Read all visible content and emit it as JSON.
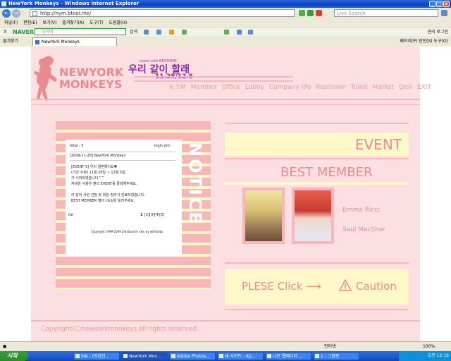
{
  "window": {
    "title": "NewYork Monkeys - Windows Internet Explorer",
    "url": "http://nym.btool.me/",
    "live_search_placeholder": "Live Search"
  },
  "menu": [
    "파일(F)",
    "편집(E)",
    "보기(V)",
    "즐겨찾기(A)",
    "도구(T)",
    "도움말(H)"
  ],
  "naver": {
    "logo": "NAVER",
    "close": "X",
    "placeholder": "네이버",
    "search_label": "검색",
    "manage": "관리",
    "login": "로그인"
  },
  "tabs": {
    "favorites": "즐겨찾기",
    "active_tab": "NewYork Monkeys",
    "tools": "페이지(P)   안전(S)   도구(O)"
  },
  "site": {
    "logo_line1": "NEWYORK",
    "logo_line2": "MONKEYS",
    "event_small": "event with BESTMEM",
    "event_title": "우리 같이 할래",
    "event_date": "11.28/12.5",
    "nav": [
      "N.Y.M",
      "Member",
      "Office",
      "Lobby",
      "Company life",
      "Restroom",
      "Toilet",
      "Market",
      "QnA",
      "EXIT"
    ],
    "notice_label": "NOTICE",
    "notice": {
      "total": "total : 5",
      "login_join": "login  join",
      "date_title": "[2009-11-28]  NewYork Monkeys",
      "lines": [
        "[EVENT 5] 우리 결혼했어요♥",
        "(기간 수정) 11월 28일 ~ 12월 5일",
        "가 시작되었습니다^^",
        "자세한 사항은 옆의 EVENT를 클릭해주세요.",
        "",
        "이 달의 사원 선정 및 회원 정리가 완료되었습니다.",
        "BEST MEMBER 옆의 click을 눌러주세요."
      ],
      "list": "list",
      "pages_current": "1",
      "pages": "[2][3][4][5]",
      "copyright": "Copyright 1999-2009 Zeroboard / skin by withbaby"
    },
    "event_label": "EVENT",
    "best_member_title": "BEST MEMBER",
    "members": [
      "Emma Ricci",
      "Saul MacSher"
    ],
    "please_click": "PLESE Click ⟶",
    "caution": "Caution",
    "copyright": "Copyright(C)newyorkmonkeys all rights reserved."
  },
  "status": {
    "zone": "인터넷",
    "zoom": "100%"
  },
  "taskbar": {
    "start": "시작",
    "tasks": [
      "SAI - (자강딘...",
      "NewYork Mon...",
      "Adobe Photos...",
      "새 사이트 - Itp...",
      "나모 웹에디터 ...",
      "1 - 그림판"
    ],
    "clock": "오전 12:16"
  }
}
